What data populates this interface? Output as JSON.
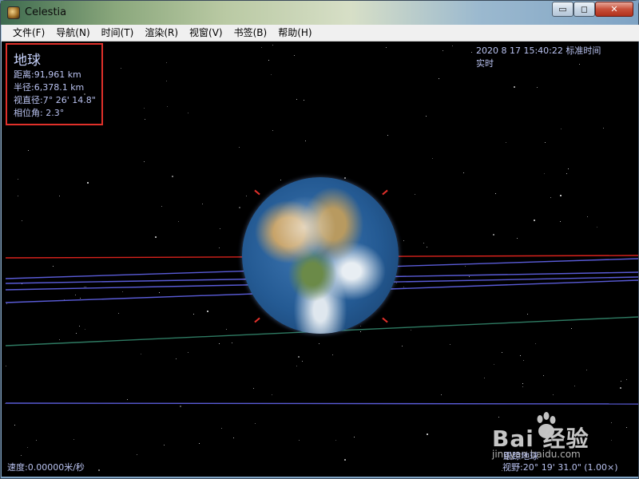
{
  "window": {
    "title": "Celestia",
    "minimize_label": "▭",
    "maximize_label": "◻",
    "close_label": "✕"
  },
  "menu": {
    "items": [
      {
        "label": "文件(F)"
      },
      {
        "label": "导航(N)"
      },
      {
        "label": "时间(T)"
      },
      {
        "label": "渲染(R)"
      },
      {
        "label": "视窗(V)"
      },
      {
        "label": "书签(B)"
      },
      {
        "label": "帮助(H)"
      }
    ]
  },
  "object_info": {
    "name": "地球",
    "distance": "距离:91,961 km",
    "radius": "半径:6,378.1 km",
    "apparent_diameter": "视直径:7° 26' 14.8\"",
    "phase_angle": "相位角: 2.3°"
  },
  "time": {
    "datetime": "2020 8 17 15:40:22 标准时间",
    "mode": "实时"
  },
  "status": {
    "speed": "速度:0.00000米/秒",
    "tracking": "跟踪地球",
    "fov": "视野:20° 19' 31.0\" (1.00×)"
  },
  "watermark": {
    "brand": "Bai  经验",
    "url": "jingyan.baidu.com"
  },
  "colors": {
    "highlight_box": "#e0302a",
    "hud_text": "#b9c2f0",
    "orbit_red": "#d8221c",
    "orbit_blue": "#5a5cd8",
    "orbit_green": "#2e7a62"
  }
}
